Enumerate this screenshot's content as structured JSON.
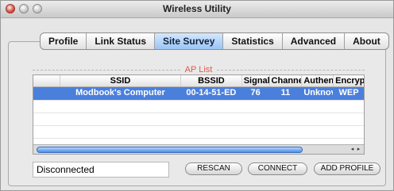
{
  "window": {
    "title": "Wireless Utility"
  },
  "tabs": [
    {
      "label": "Profile",
      "active": false
    },
    {
      "label": "Link Status",
      "active": false
    },
    {
      "label": "Site Survey",
      "active": true
    },
    {
      "label": "Statistics",
      "active": false
    },
    {
      "label": "Advanced",
      "active": false
    },
    {
      "label": "About",
      "active": false
    }
  ],
  "ap_list": {
    "title": "AP List",
    "columns": [
      "",
      "SSID",
      "BSSID",
      "Signal",
      "Channel",
      "Authen",
      "Encryp"
    ],
    "rows": [
      {
        "selected": true,
        "cells": [
          "",
          "Modbook's Computer",
          "00-14-51-ED",
          "76",
          "11",
          "Unknov",
          "WEP"
        ]
      }
    ]
  },
  "status": {
    "text": "Disconnected"
  },
  "buttons": {
    "rescan": "RESCAN",
    "connect": "CONNECT",
    "add_profile": "ADD PROFILE"
  },
  "scrollbar": {
    "arrow_left": "◂",
    "arrow_right": "▸"
  }
}
